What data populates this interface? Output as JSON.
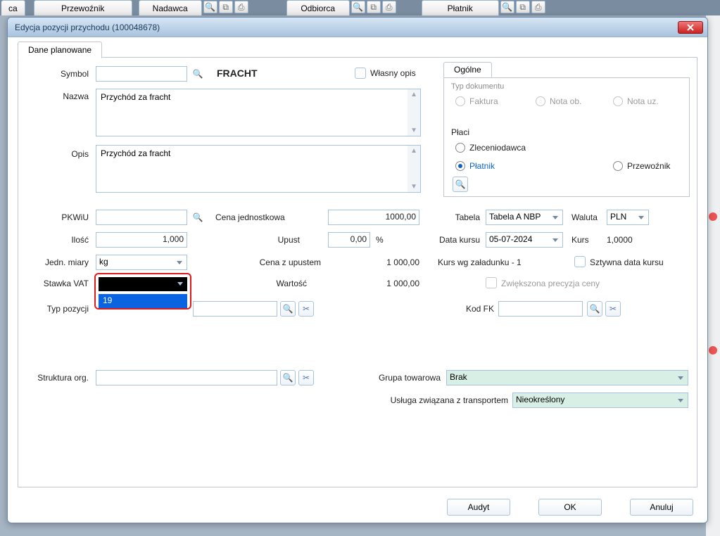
{
  "toolbar": {
    "tab_partial": "ca",
    "tab_przewoznik": "Przewoźnik",
    "tab_nadawca": "Nadawca",
    "tab_odbiorca": "Odbiorca",
    "tab_platnik": "Płatnik"
  },
  "dialog": {
    "title": "Edycja pozycji przychodu (100048678)",
    "tab_label": "Dane planowane",
    "labels": {
      "symbol": "Symbol",
      "nazwa": "Nazwa",
      "opis": "Opis",
      "pkwiu": "PKWiU",
      "ilosc": "Ilość",
      "jedn": "Jedn. miary",
      "stawka": "Stawka VAT",
      "typpoz": "Typ pozycji",
      "struktura": "Struktura org.",
      "cena_j": "Cena jednostkowa",
      "upust": "Upust",
      "cena_up": "Cena z upustem",
      "wartosc": "Wartość",
      "percent": "%",
      "ogolne_tab": "Ogólne",
      "typdok": "Typ dokumentu",
      "faktura": "Faktura",
      "nota_ob": "Nota ob.",
      "nota_uz": "Nota uz.",
      "placi": "Płaci",
      "zleceniodawca": "Zleceniodawca",
      "platnik": "Płatnik",
      "przewoznik": "Przewoźnik",
      "tabela": "Tabela",
      "waluta": "Waluta",
      "data_kursu": "Data kursu",
      "kurs": "Kurs",
      "kurs_wg": "Kurs wg załadunku - 1",
      "sztywna": "Sztywna data kursu",
      "zwiekszona": "Zwiększona  precyzja ceny",
      "kod_fk": "Kod FK",
      "grupa_tow": "Grupa towarowa",
      "usluga": "Usługa związana z transportem",
      "wlasny_opis": "Własny opis"
    },
    "values": {
      "symbol_value": "",
      "symbol_title": "FRACHT",
      "nazwa": "Przychód za fracht",
      "opis": "Przychód za fracht",
      "pkwiu": "",
      "ilosc": "1,000",
      "jedn": "kg",
      "stawka_display": "",
      "stawka_option": "19",
      "typpoz": "",
      "struktura": "",
      "cena_j": "1000,00",
      "upust": "0,00",
      "cena_up": "1 000,00",
      "wartosc": "1 000,00",
      "tabela": "Tabela A NBP",
      "waluta": "PLN",
      "data_kursu": "05-07-2024",
      "kurs": "1,0000",
      "kod_fk": "",
      "grupa_tow": "Brak",
      "usluga": "Nieokreślony"
    },
    "buttons": {
      "audyt": "Audyt",
      "ok": "OK",
      "anuluj": "Anuluj"
    }
  }
}
